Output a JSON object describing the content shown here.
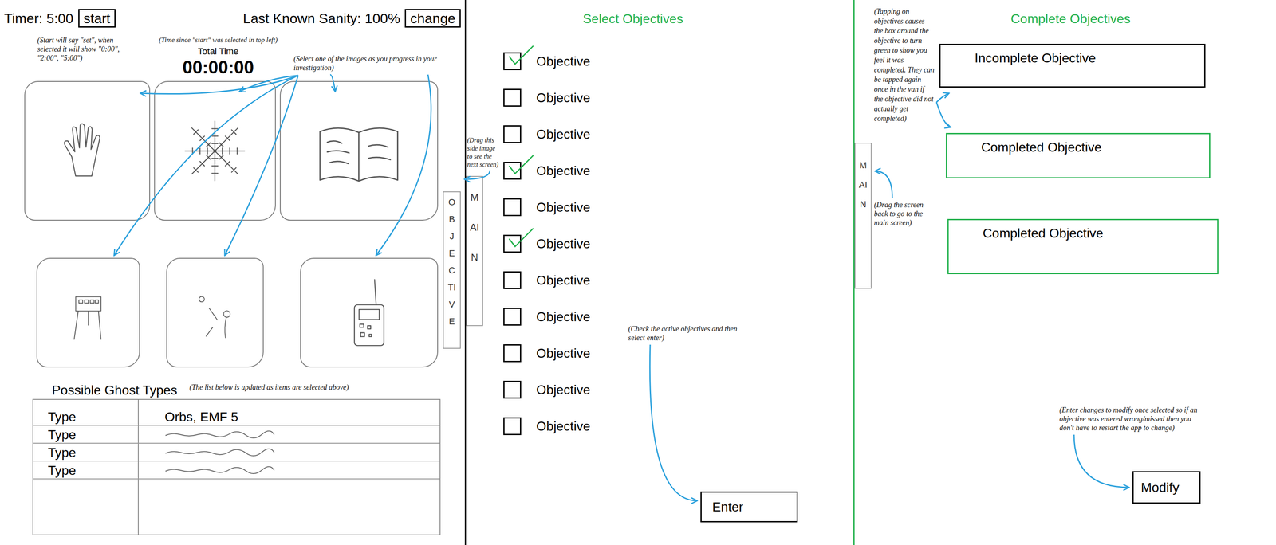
{
  "left": {
    "timer": {
      "label": "Timer: 5:00",
      "button": "start"
    },
    "sanity": {
      "label": "Last Known Sanity: 100%",
      "button": "change"
    },
    "total_time": {
      "label": "Total Time",
      "value": "00:00:00"
    },
    "notes": {
      "start": "(Start will say \"set\", when selected it will show \"0:00\", \"2:00\", \"5:00\")",
      "total_time": "(Time since \"start\" was selected in top left)",
      "tiles": "(Select one of the images as you progress in your investigation)"
    },
    "evidence_tiles": [
      {
        "kind": "hand",
        "selected": false
      },
      {
        "kind": "web",
        "selected": false
      },
      {
        "kind": "book",
        "selected": false
      },
      {
        "kind": "stand",
        "selected": false
      },
      {
        "kind": "orb",
        "selected": false
      },
      {
        "kind": "device",
        "selected": false
      }
    ],
    "ghost_types": {
      "title": "Possible Ghost Types",
      "note": "(The list below is updated as items are selected above)",
      "rows": [
        {
          "type": "Type",
          "kind": "text",
          "evidence": "Orbs, EMF 5"
        },
        {
          "type": "Type",
          "kind": "scribble"
        },
        {
          "type": "Type",
          "kind": "scribble"
        },
        {
          "type": "Type",
          "kind": "scribble"
        }
      ]
    },
    "side_tab": "OBJECTIVE"
  },
  "select_objectives": {
    "title": "Select Objectives",
    "side_tab": "MAIN",
    "drag_note": "(Drag this side image to see the next screen)",
    "items": [
      {
        "label": "Objective",
        "checked": true
      },
      {
        "label": "Objective",
        "checked": false
      },
      {
        "label": "Objective",
        "checked": false
      },
      {
        "label": "Objective",
        "checked": true
      },
      {
        "label": "Objective",
        "checked": false
      },
      {
        "label": "Objective",
        "checked": true
      },
      {
        "label": "Objective",
        "checked": false
      },
      {
        "label": "Objective",
        "checked": false
      },
      {
        "label": "Objective",
        "checked": false
      },
      {
        "label": "Objective",
        "checked": false
      },
      {
        "label": "Objective",
        "checked": false
      }
    ],
    "enter_note": "(Check the active objectives and then select enter)",
    "button": "Enter"
  },
  "complete_objectives": {
    "title": "Complete Objectives",
    "side_tab": "MAIN",
    "tap_note": "(Tapping on objectives causes the box around the objective to turn green to show you feel it was completed. They can be tapped again once in the van if the objective did not actually get completed)",
    "drag_note": "(Drag the screen back to go to the main screen)",
    "items": [
      {
        "label": "Incomplete Objective",
        "completed": false
      },
      {
        "label": "Completed Objective",
        "completed": true
      },
      {
        "label": "Completed Objective",
        "completed": true
      }
    ],
    "modify_note": "(Enter changes to modify once selected so if an objective was entered wrong/missed then you don't have to restart the app to change)",
    "button": "Modify"
  }
}
